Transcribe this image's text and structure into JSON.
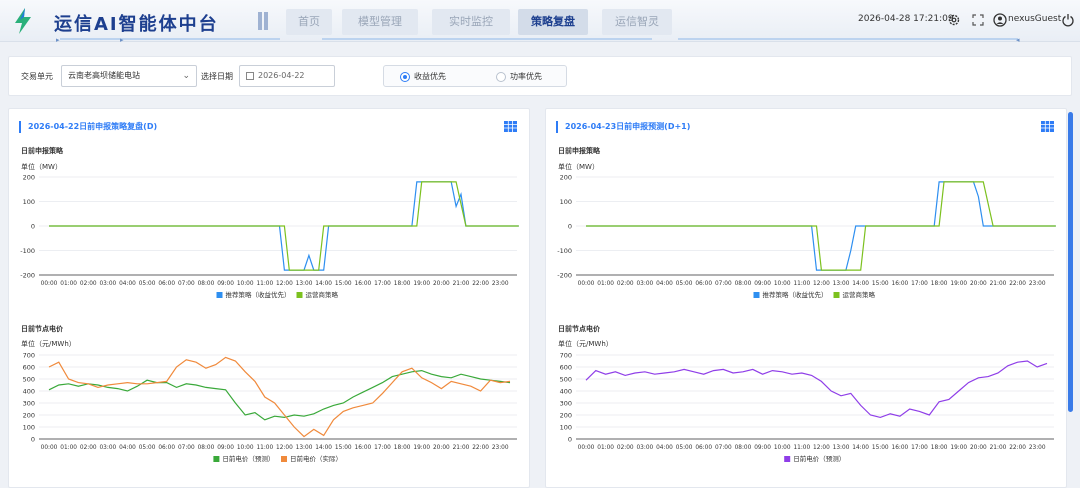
{
  "header": {
    "title": "运信AI智能体中台",
    "tabs": [
      {
        "label": "首页",
        "active": false
      },
      {
        "label": "模型管理",
        "active": false
      },
      {
        "label": "实时监控",
        "active": false
      },
      {
        "label": "策略复盘",
        "active": true
      },
      {
        "label": "运信智灵",
        "active": false
      }
    ],
    "datetime": "2026-04-28 17:21:09",
    "username": "nexusGuest",
    "icons": [
      "settings-icon",
      "fullscreen-icon",
      "user-icon",
      "power-icon"
    ]
  },
  "filter": {
    "unit_label": "交易单元",
    "unit_value": "云南老高坝储能电站",
    "date_label": "选择日期",
    "date_value": "2026-04-22",
    "radios": [
      {
        "label": "收益优先",
        "checked": true
      },
      {
        "label": "功率优先",
        "checked": false
      }
    ]
  },
  "panels": [
    {
      "title": "2026-04-22日前申报策略复盘(D)",
      "strategy_title": "日前申报策略",
      "strategy_unit": "单位（MW）",
      "price_title": "日前节点电价",
      "price_unit": "单位（元/MWh）"
    },
    {
      "title": "2026-04-23日前申报预测(D+1)",
      "strategy_title": "日前申报策略",
      "strategy_unit": "单位（MW）",
      "price_title": "日前节点电价",
      "price_unit": "单位（元/MWh）"
    }
  ],
  "colors": {
    "blue": "#2e8ff0",
    "green": "#7cc11f",
    "darkgreen": "#3aa93a",
    "orange": "#f08a3c",
    "purple": "#8f3ee8",
    "accent": "#2e7cf6"
  },
  "chart_data": [
    {
      "type": "line",
      "ylim": [
        -200,
        200
      ],
      "yticks": [
        -200,
        -100,
        0,
        100,
        200
      ],
      "x": [
        "00:00",
        "01:00",
        "02:00",
        "03:00",
        "04:00",
        "05:00",
        "06:00",
        "07:00",
        "08:00",
        "09:00",
        "10:00",
        "11:00",
        "12:00",
        "13:00",
        "14:00",
        "15:00",
        "16:00",
        "17:00",
        "18:00",
        "19:00",
        "20:00",
        "21:00",
        "22:00",
        "23:00"
      ],
      "series": [
        {
          "name": "推荐策略（收益优先）",
          "color": "#2e8ff0",
          "points": [
            [
              0,
              0
            ],
            [
              11.75,
              0
            ],
            [
              12,
              -180
            ],
            [
              13,
              -180
            ],
            [
              13.25,
              -120
            ],
            [
              13.5,
              -180
            ],
            [
              14,
              -180
            ],
            [
              14.25,
              0
            ],
            [
              18.5,
              0
            ],
            [
              18.75,
              180
            ],
            [
              20.5,
              180
            ],
            [
              20.75,
              80
            ],
            [
              21,
              130
            ],
            [
              21.25,
              0
            ],
            [
              23.95,
              0
            ]
          ]
        },
        {
          "name": "运营商策略",
          "color": "#7cc11f",
          "points": [
            [
              0,
              0
            ],
            [
              12,
              0
            ],
            [
              12.25,
              -180
            ],
            [
              13.75,
              -180
            ],
            [
              14,
              0
            ],
            [
              18.75,
              0
            ],
            [
              19,
              180
            ],
            [
              20.75,
              180
            ],
            [
              21.25,
              0
            ],
            [
              23.95,
              0
            ]
          ]
        }
      ]
    },
    {
      "type": "line",
      "ylim": [
        0,
        700
      ],
      "yticks": [
        0,
        100,
        200,
        300,
        400,
        500,
        600,
        700
      ],
      "x": [
        "00:00",
        "01:00",
        "02:00",
        "03:00",
        "04:00",
        "05:00",
        "06:00",
        "07:00",
        "08:00",
        "09:00",
        "10:00",
        "11:00",
        "12:00",
        "13:00",
        "14:00",
        "15:00",
        "16:00",
        "17:00",
        "18:00",
        "19:00",
        "20:00",
        "21:00",
        "22:00",
        "23:00"
      ],
      "series": [
        {
          "name": "日前电价（预测）",
          "color": "#3aa93a",
          "values": [
            410,
            450,
            460,
            440,
            460,
            450,
            430,
            420,
            400,
            440,
            490,
            470,
            470,
            430,
            460,
            450,
            430,
            420,
            410,
            300,
            200,
            220,
            160,
            190,
            180,
            200,
            190,
            210,
            250,
            280,
            300,
            350,
            390,
            430,
            470,
            520,
            540,
            560,
            570,
            540,
            520,
            510,
            540,
            520,
            500,
            490,
            480,
            470
          ]
        },
        {
          "name": "日前电价（实际）",
          "color": "#f08a3c",
          "values": [
            600,
            640,
            500,
            470,
            460,
            430,
            450,
            460,
            470,
            460,
            460,
            470,
            480,
            600,
            660,
            640,
            590,
            620,
            680,
            650,
            560,
            480,
            350,
            300,
            200,
            100,
            20,
            80,
            30,
            160,
            230,
            260,
            280,
            300,
            380,
            470,
            560,
            590,
            510,
            470,
            420,
            480,
            460,
            440,
            400,
            490,
            470,
            480
          ]
        }
      ]
    },
    {
      "type": "line",
      "ylim": [
        -200,
        200
      ],
      "yticks": [
        -200,
        -100,
        0,
        100,
        200
      ],
      "x": [
        "00:00",
        "01:00",
        "02:00",
        "03:00",
        "04:00",
        "05:00",
        "06:00",
        "07:00",
        "08:00",
        "09:00",
        "10:00",
        "11:00",
        "12:00",
        "13:00",
        "14:00",
        "15:00",
        "16:00",
        "17:00",
        "18:00",
        "19:00",
        "20:00",
        "21:00",
        "22:00",
        "23:00"
      ],
      "series": [
        {
          "name": "推荐策略（收益优先）",
          "color": "#2e8ff0",
          "points": [
            [
              0,
              0
            ],
            [
              11.5,
              0
            ],
            [
              11.75,
              -180
            ],
            [
              13.25,
              -180
            ],
            [
              13.5,
              -100
            ],
            [
              13.75,
              0
            ],
            [
              17.75,
              0
            ],
            [
              18,
              180
            ],
            [
              19.75,
              180
            ],
            [
              20,
              120
            ],
            [
              20.25,
              0
            ],
            [
              23.95,
              0
            ]
          ]
        },
        {
          "name": "运营商策略",
          "color": "#7cc11f",
          "points": [
            [
              0,
              0
            ],
            [
              11.75,
              0
            ],
            [
              12,
              -180
            ],
            [
              14,
              -180
            ],
            [
              14.25,
              0
            ],
            [
              18,
              0
            ],
            [
              18.25,
              180
            ],
            [
              20.25,
              180
            ],
            [
              20.75,
              0
            ],
            [
              23.95,
              0
            ]
          ]
        }
      ]
    },
    {
      "type": "line",
      "ylim": [
        0,
        700
      ],
      "yticks": [
        0,
        100,
        200,
        300,
        400,
        500,
        600,
        700
      ],
      "x": [
        "00:00",
        "01:00",
        "02:00",
        "03:00",
        "04:00",
        "05:00",
        "06:00",
        "07:00",
        "08:00",
        "09:00",
        "10:00",
        "11:00",
        "12:00",
        "13:00",
        "14:00",
        "15:00",
        "16:00",
        "17:00",
        "18:00",
        "19:00",
        "20:00",
        "21:00",
        "22:00",
        "23:00"
      ],
      "series": [
        {
          "name": "日前电价（预测）",
          "color": "#8f3ee8",
          "values": [
            490,
            570,
            540,
            560,
            530,
            550,
            560,
            540,
            550,
            560,
            580,
            560,
            540,
            570,
            580,
            550,
            560,
            580,
            540,
            570,
            560,
            540,
            550,
            530,
            480,
            400,
            360,
            380,
            280,
            200,
            180,
            210,
            190,
            250,
            230,
            200,
            310,
            330,
            400,
            470,
            510,
            520,
            550,
            610,
            640,
            650,
            600,
            630
          ]
        }
      ]
    }
  ]
}
